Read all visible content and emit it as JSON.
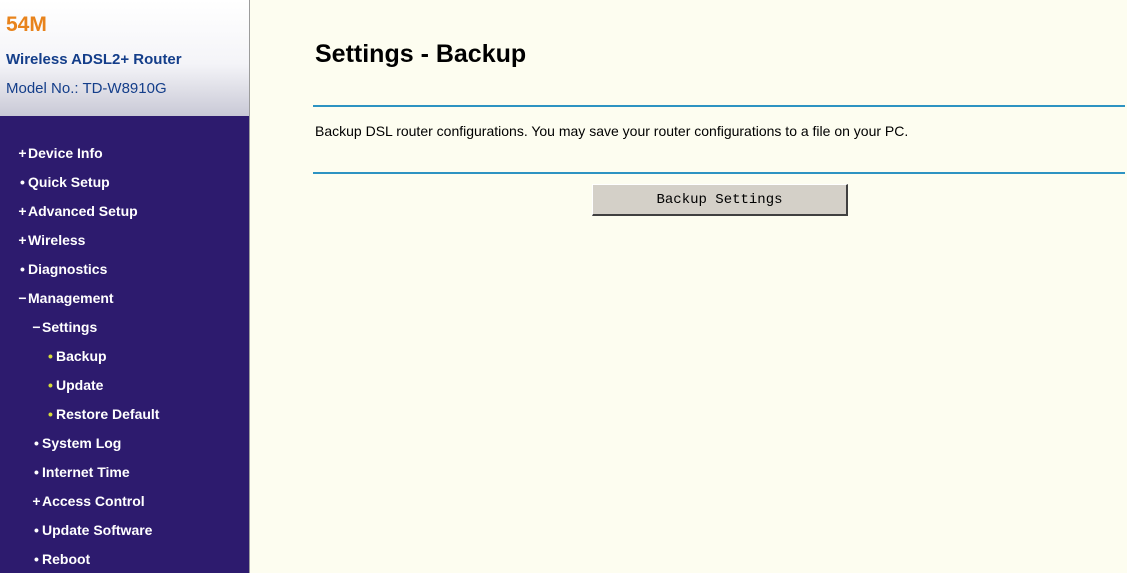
{
  "brand": {
    "speed": "54M",
    "product": "Wireless ADSL2+ Router",
    "model_label": "Model No.: ",
    "model_number": "TD-W8910G"
  },
  "menu": {
    "items": [
      {
        "marker": "+",
        "label": "Device Info"
      },
      {
        "marker": "•",
        "label": "Quick Setup"
      },
      {
        "marker": "+",
        "label": "Advanced Setup"
      },
      {
        "marker": "+",
        "label": "Wireless"
      },
      {
        "marker": "•",
        "label": "Diagnostics"
      },
      {
        "marker": "−",
        "label": "Management"
      },
      {
        "marker": "−",
        "label": "Settings"
      },
      {
        "marker": "•",
        "label": "Backup"
      },
      {
        "marker": "•",
        "label": "Update"
      },
      {
        "marker": "•",
        "label": "Restore Default"
      },
      {
        "marker": "•",
        "label": "System Log"
      },
      {
        "marker": "•",
        "label": "Internet Time"
      },
      {
        "marker": "+",
        "label": "Access Control"
      },
      {
        "marker": "•",
        "label": "Update Software"
      },
      {
        "marker": "•",
        "label": "Reboot"
      }
    ]
  },
  "main": {
    "title": "Settings - Backup",
    "description": "Backup DSL router configurations. You may save your router configurations to a file on your PC.",
    "backup_button_label": "Backup Settings"
  },
  "colors": {
    "menu_background": "#2d1b6e",
    "content_background": "#fdfdf0",
    "rule_color": "#2d93c2",
    "brand_accent": "#e8831c",
    "brand_text": "#143e8a"
  }
}
